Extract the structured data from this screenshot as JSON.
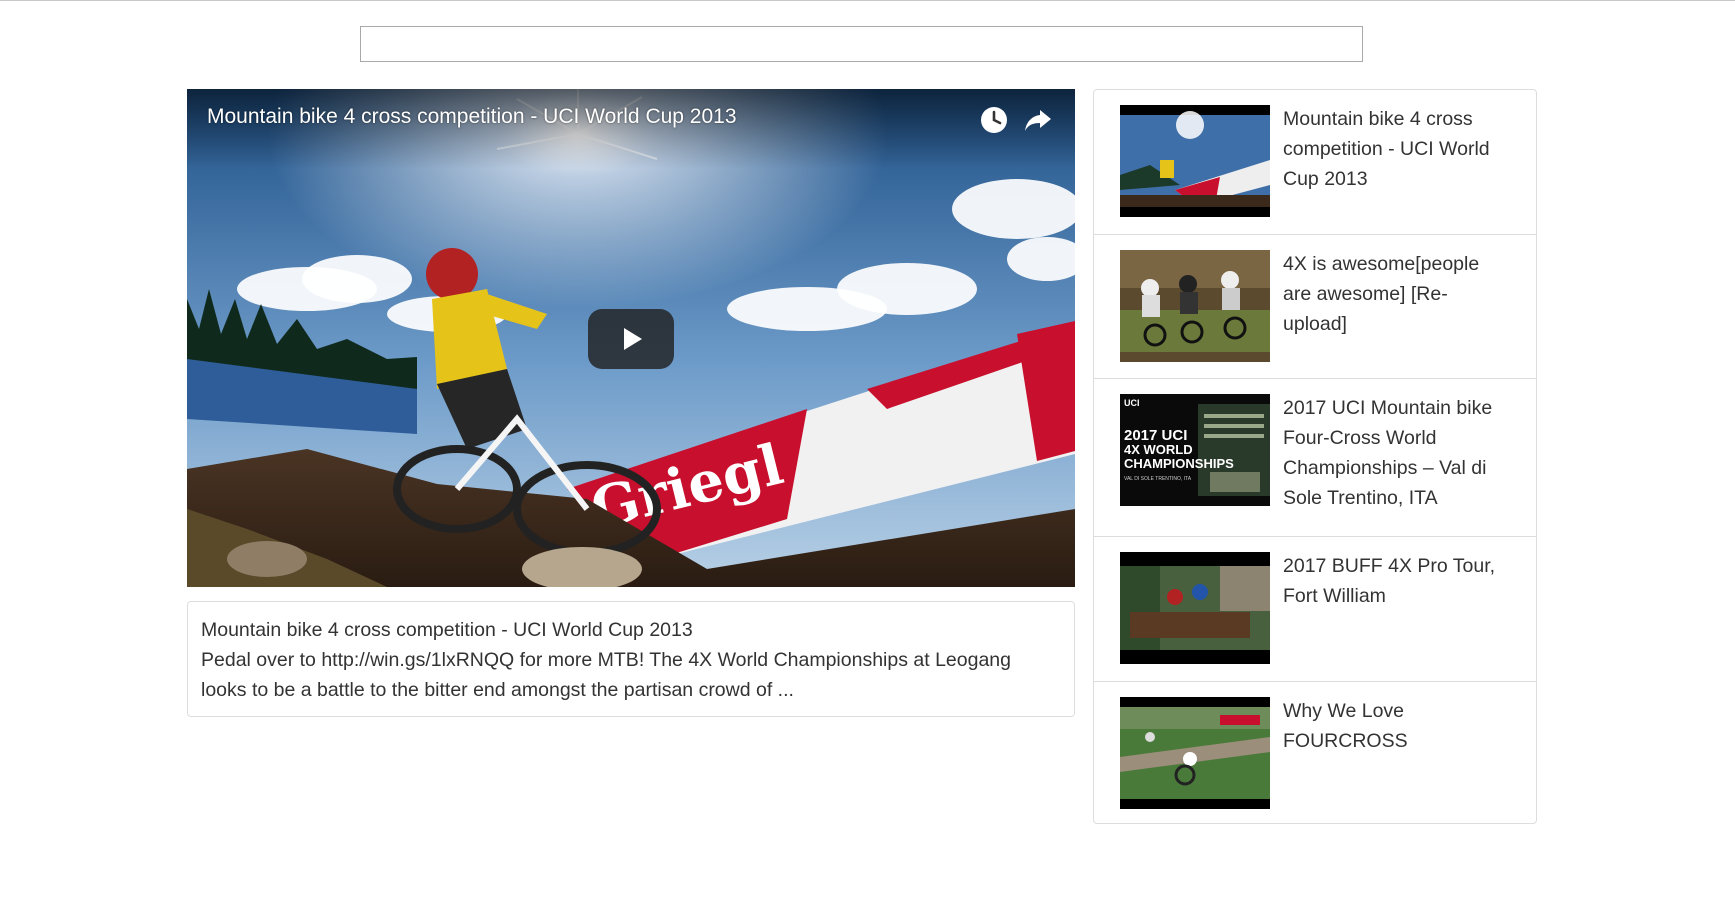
{
  "search": {
    "value": "",
    "placeholder": ""
  },
  "player": {
    "title": "Mountain bike 4 cross competition - UCI World Cup 2013",
    "icons": [
      "clock-icon",
      "share-icon",
      "play-icon"
    ],
    "banner_text": "Griegl"
  },
  "description": {
    "title": "Mountain bike 4 cross competition - UCI World Cup 2013",
    "text": "Pedal over to http://win.gs/1lxRNQQ for more MTB! The 4X World Championships at Leogang looks to be a battle to the bitter end amongst the partisan crowd of ..."
  },
  "videos": [
    {
      "title": "Mountain bike 4 cross competition - UCI World Cup 2013",
      "thumb_text": ""
    },
    {
      "title": "4X is awesome[people are awesome] [Re-upload]",
      "thumb_text": ""
    },
    {
      "title": "2017 UCI Mountain bike Four-Cross World Championships – Val di Sole Trentino, ITA",
      "thumb_text": "2017 UCI 4X WORLD CHAMPIONSHIPS",
      "thumb_sub": "VAL DI SOLE TRENTINO, ITA",
      "thumb_badge": "UCI"
    },
    {
      "title": "2017 BUFF 4X Pro Tour, Fort William",
      "thumb_text": ""
    },
    {
      "title": "Why We Love FOURCROSS",
      "thumb_text": ""
    }
  ],
  "colors": {
    "border": "#dddddd",
    "text": "#333333",
    "banner_red": "#c8102e",
    "rider_yellow": "#e6c319"
  }
}
